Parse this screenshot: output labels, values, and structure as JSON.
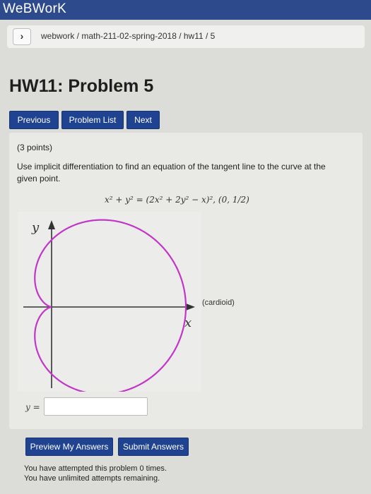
{
  "app": {
    "brand": "WeBWorK"
  },
  "breadcrumb": {
    "path": "webwork / math-211-02-spring-2018 / hw11 / 5"
  },
  "page": {
    "title": "HW11: Problem 5"
  },
  "nav": {
    "previous_label": "Previous",
    "problem_list_label": "Problem List",
    "next_label": "Next"
  },
  "problem": {
    "points": "(3 points)",
    "question": "Use implicit differentiation to find an equation of the tangent line to the curve at the given point.",
    "equation": "x² + y² = (2x² + 2y² − x)², (0, 1/2)",
    "figure": {
      "y_axis_label": "y",
      "x_axis_label": "x",
      "curve_label": "(cardioid)",
      "curve_color": "#c236c7"
    },
    "answer_label": "y =",
    "answer_value": ""
  },
  "actions": {
    "preview_label": "Preview My Answers",
    "submit_label": "Submit Answers"
  },
  "status": {
    "attempted": "You have attempted this problem 0 times.",
    "remaining": "You have unlimited attempts remaining."
  }
}
